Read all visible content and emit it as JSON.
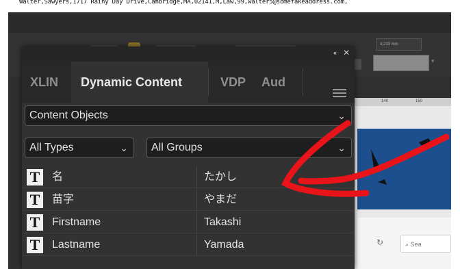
{
  "csv_line": "Walter,Sawyers,1717 Rainy Day Drive,Cambridge,MA,02141,M,Law,99,walter5@somefakeaddress.com,",
  "toolbar": {
    "field_value": "4,233 mm"
  },
  "ruler": {
    "tick_140": "140",
    "tick_150": "150"
  },
  "doc_search": {
    "icon_glyph": "⌕",
    "placeholder": "Sea"
  },
  "panel": {
    "collapse_glyph": "«",
    "close_glyph": "✕",
    "tabs": [
      {
        "label": "XLIN",
        "active": false
      },
      {
        "label": "Dynamic Content",
        "active": true
      },
      {
        "label": "VDP",
        "active": false
      },
      {
        "label": "Aud",
        "active": false
      }
    ],
    "content_dropdown": "Content Objects",
    "types_dropdown": "All Types",
    "groups_dropdown": "All Groups",
    "rows": [
      {
        "icon": "T",
        "name": "名",
        "value": "たかし"
      },
      {
        "icon": "T",
        "name": "苗字",
        "value": "やまだ"
      },
      {
        "icon": "T",
        "name": "Firstname",
        "value": "Takashi"
      },
      {
        "icon": "T",
        "name": "Lastname",
        "value": "Yamada"
      }
    ]
  },
  "annotation": {
    "color": "#e8141a"
  },
  "colors": {
    "panel_bg": "#323232",
    "tab_active_text": "#e8e8e8",
    "doc_blue": "#1d4f8f"
  }
}
